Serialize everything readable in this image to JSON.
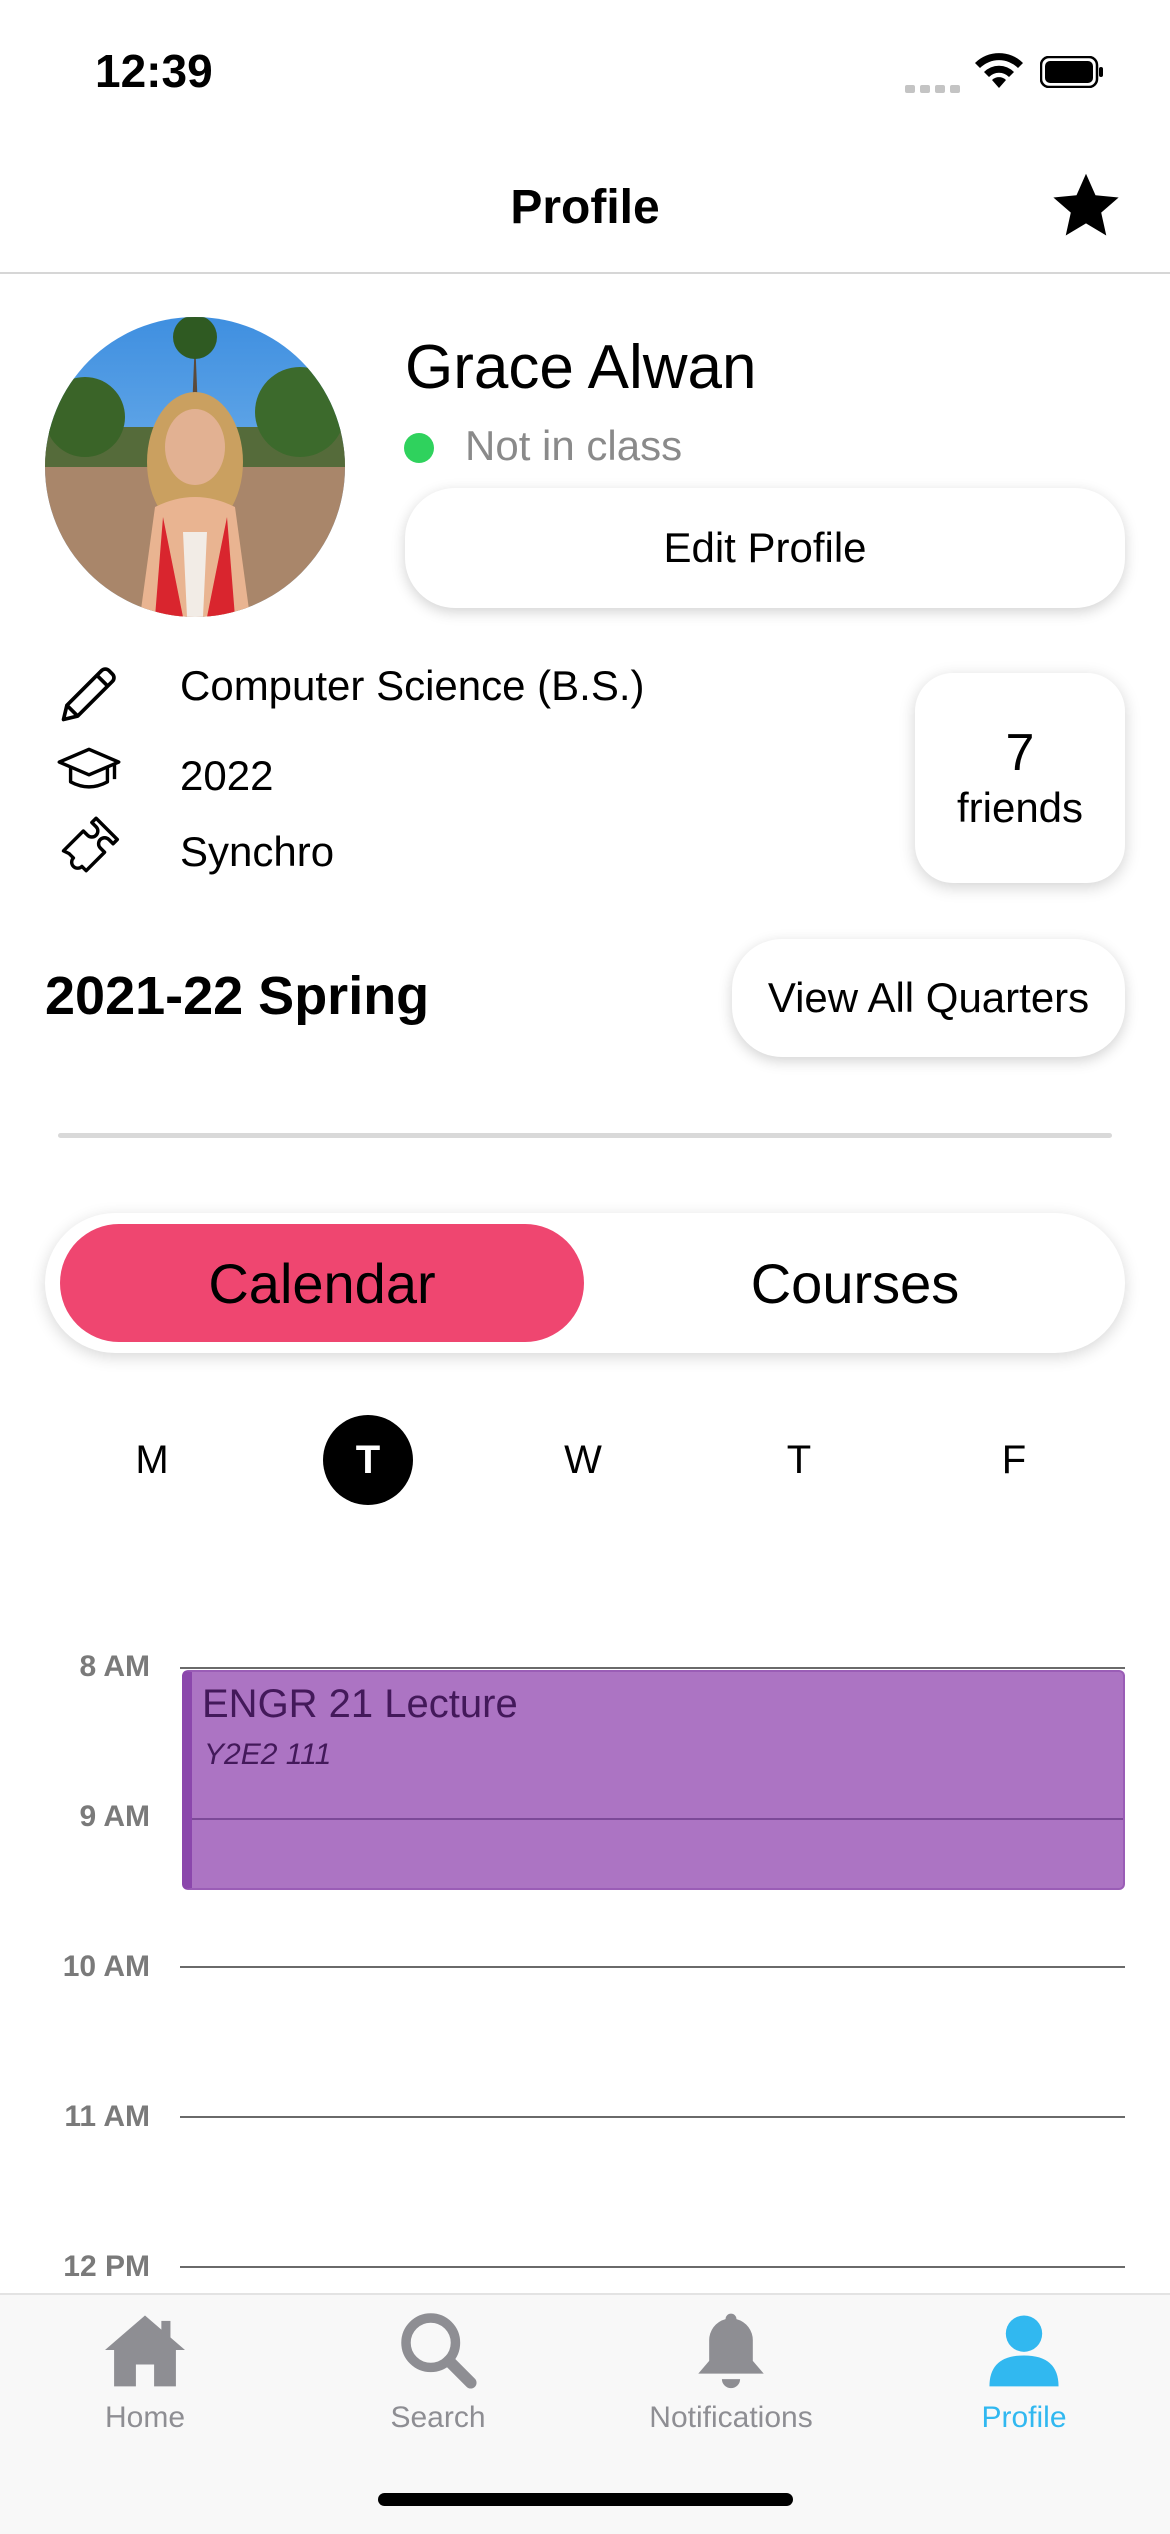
{
  "status_bar": {
    "time": "12:39"
  },
  "nav": {
    "title": "Profile",
    "favorite_icon": "star-icon"
  },
  "profile": {
    "name": "Grace Alwan",
    "status": "Not in class",
    "status_color": "#2fd25d",
    "edit_label": "Edit Profile",
    "major": "Computer Science (B.S.)",
    "grad_year": "2022",
    "activity": "Synchro",
    "friends_count": "7",
    "friends_label": "friends"
  },
  "quarter": {
    "label": "2021-22 Spring",
    "view_all_label": "View All Quarters"
  },
  "segmented": {
    "calendar_label": "Calendar",
    "courses_label": "Courses",
    "active": "Calendar",
    "accent": "#ef4670"
  },
  "weekdays": [
    "M",
    "T",
    "W",
    "T",
    "F"
  ],
  "selected_day_index": 1,
  "timeline": {
    "hours": [
      "8 AM",
      "9 AM",
      "10 AM",
      "11 AM",
      "12 PM"
    ],
    "events": [
      {
        "title": "ENGR 21 Lecture",
        "room": "Y2E2 111",
        "color": "#ac74c3"
      }
    ]
  },
  "tabbar": {
    "items": [
      {
        "label": "Home",
        "icon": "home-icon"
      },
      {
        "label": "Search",
        "icon": "search-icon"
      },
      {
        "label": "Notifications",
        "icon": "bell-icon"
      },
      {
        "label": "Profile",
        "icon": "person-icon"
      }
    ],
    "active": "Profile",
    "active_color": "#31b8f0"
  }
}
